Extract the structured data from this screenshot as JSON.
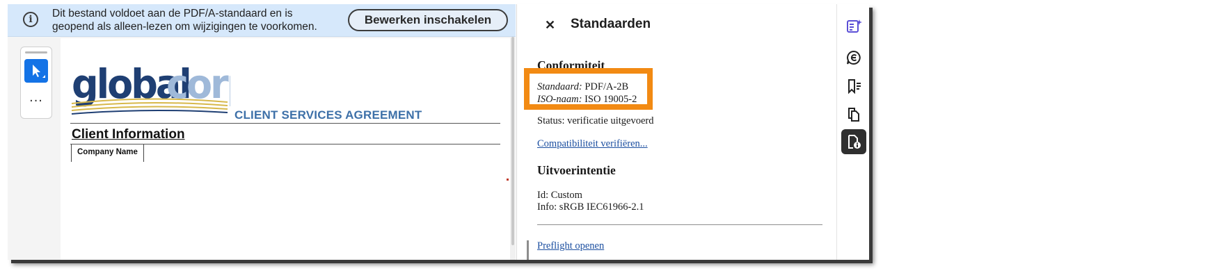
{
  "notification": {
    "message": "Dit bestand voldoet aan de PDF/A-standaard en is geopend als alleen-lezen om wijzigingen te voorkomen.",
    "enable_button": "Bewerken inschakelen",
    "icon": "info-icon"
  },
  "toolbox": {
    "select_icon": "cursor-arrow-icon",
    "more_label": "..."
  },
  "document": {
    "logo_text": "globalcorp",
    "subtitle": "CLIENT SERVICES AGREEMENT",
    "section_heading": "Client Information",
    "field_label": "Company Name"
  },
  "panel": {
    "title": "Standaarden",
    "close_icon": "close-icon",
    "conformity": {
      "heading": "Conformiteit",
      "standard_label": "Standaard:",
      "standard_value": "PDF/A-2B",
      "iso_label": "ISO-naam:",
      "iso_value": "ISO 19005-2",
      "status": "Status: verificatie uitgevoerd",
      "verify_link": "Compatibiliteit verifiëren..."
    },
    "output_intent": {
      "heading": "Uitvoerintentie",
      "id": "Id: Custom",
      "info": "Info: sRGB IEC61966-2.1"
    },
    "preflight_link": "Preflight openen",
    "highlight_color": "#f28a13"
  },
  "rail": {
    "items": [
      {
        "icon": "edit-pdf-icon",
        "active": false,
        "color": "#5b4fd6"
      },
      {
        "icon": "comment-icon",
        "active": false
      },
      {
        "icon": "bookmark-icon",
        "active": false
      },
      {
        "icon": "pages-icon",
        "active": false
      },
      {
        "icon": "standards-icon",
        "active": true
      }
    ]
  }
}
